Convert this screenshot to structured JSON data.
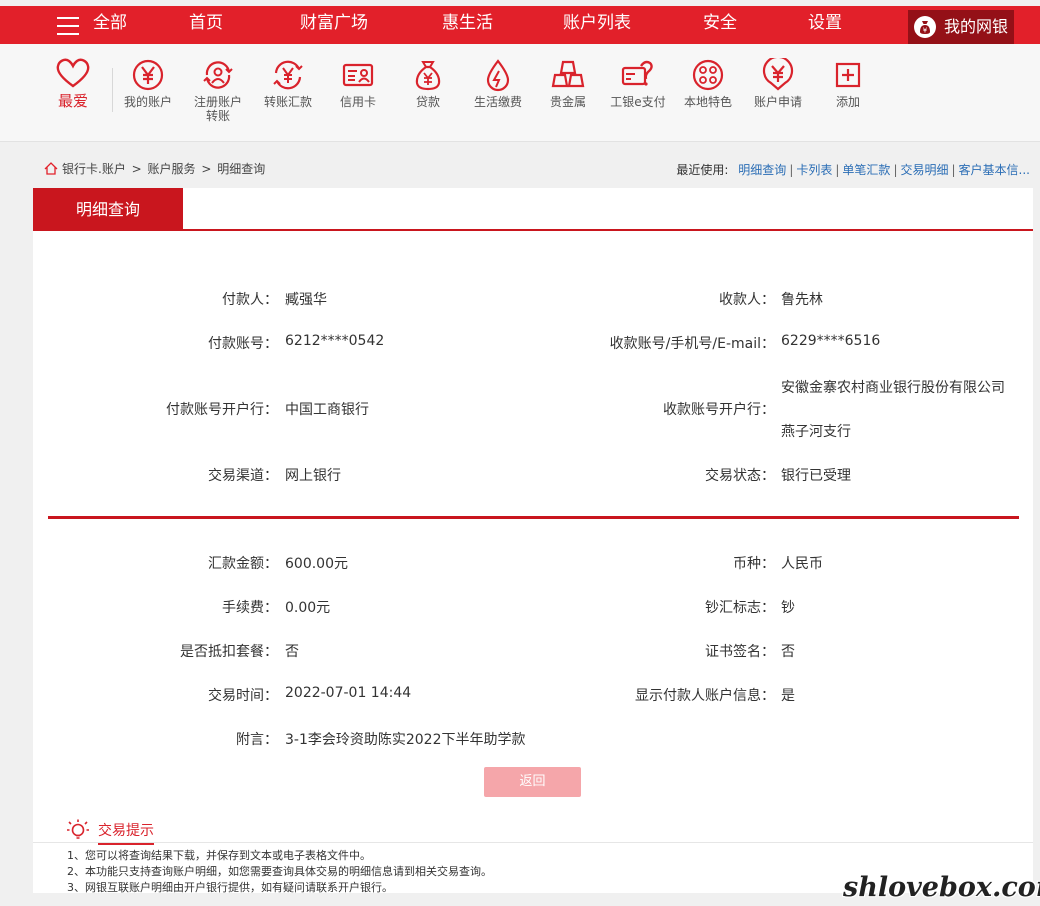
{
  "nav": {
    "all": "全部",
    "items": [
      "首页",
      "财富广场",
      "惠生活",
      "账户列表",
      "安全",
      "设置"
    ],
    "mybank": "我的网银"
  },
  "quick": {
    "fav": "最爱",
    "items": [
      {
        "label": "我的账户",
        "icon": "yen-icon"
      },
      {
        "label": "注册账户转账",
        "icon": "register-transfer-icon"
      },
      {
        "label": "转账汇款",
        "icon": "transfer-icon"
      },
      {
        "label": "信用卡",
        "icon": "credit-card-icon"
      },
      {
        "label": "贷款",
        "icon": "loan-bag-icon"
      },
      {
        "label": "生活缴费",
        "icon": "utility-drop-icon"
      },
      {
        "label": "贵金属",
        "icon": "gold-bars-icon"
      },
      {
        "label": "工银e支付",
        "icon": "epay-icon"
      },
      {
        "label": "本地特色",
        "icon": "local-icon"
      },
      {
        "label": "账户申请",
        "icon": "account-apply-icon"
      },
      {
        "label": "添加",
        "icon": "add-icon"
      }
    ]
  },
  "breadcrumb": {
    "c1": "银行卡.账户",
    "c2": "账户服务",
    "c3": "明细查询"
  },
  "recent": {
    "label": "最近使用:",
    "links": [
      "明细查询",
      "卡列表",
      "单笔汇款",
      "交易明细",
      "客户基本信..."
    ]
  },
  "tab": "明细查询",
  "details": {
    "payer_label": "付款人：",
    "payer": "臧强华",
    "payee_label": "收款人：",
    "payee": "鲁先林",
    "payer_acct_label": "付款账号：",
    "payer_acct": "6212****0542",
    "payee_acct_label": "收款账号/手机号/E-mail：",
    "payee_acct": "6229****6516",
    "payer_bank_label": "付款账号开户行：",
    "payer_bank": "中国工商银行",
    "payee_bank_label": "收款账号开户行：",
    "payee_bank_1": "安徽金寨农村商业银行股份有限公司",
    "payee_bank_2": "燕子河支行",
    "channel_label": "交易渠道：",
    "channel": "网上银行",
    "status_label": "交易状态：",
    "status": "银行已受理",
    "amount_label": "汇款金额：",
    "amount": "600.00元",
    "currency_label": "币种：",
    "currency": "人民币",
    "fee_label": "手续费：",
    "fee": "0.00元",
    "cash_label": "钞汇标志：",
    "cash": "钞",
    "package_label": "是否抵扣套餐：",
    "package": "否",
    "cert_label": "证书签名：",
    "cert": "否",
    "time_label": "交易时间：",
    "time": "2022-07-01 14:44",
    "show_label": "显示付款人账户信息：",
    "show": "是",
    "note_label": "附言：",
    "note": "3-1李会玲资助陈实2022下半年助学款"
  },
  "back_button": "返回",
  "tips": {
    "title": "交易提示",
    "lines": [
      "1、您可以将查询结果下载，并保存到文本或电子表格文件中。",
      "2、本功能只支持查询账户明细，如您需要查询具体交易的明细信息请到相关交易查询。",
      "3、网银互联账户明细由开户银行提供，如有疑问请联系开户银行。"
    ]
  },
  "watermark": "shlovebox.com",
  "colors": {
    "brand_red": "#e2202a",
    "dark_red": "#c9161e",
    "link_blue": "#2a6db5"
  }
}
